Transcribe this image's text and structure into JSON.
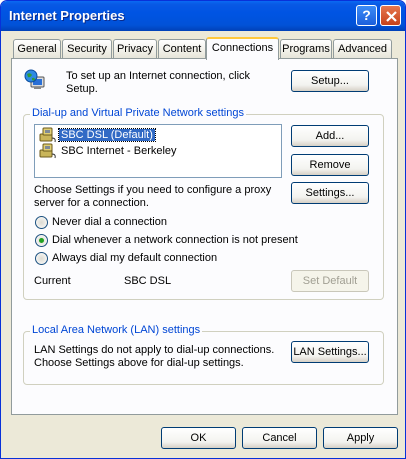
{
  "window": {
    "title": "Internet Properties",
    "help_glyph": "?",
    "close_icon": "close-x-icon"
  },
  "tabs": [
    {
      "label": "General"
    },
    {
      "label": "Security"
    },
    {
      "label": "Privacy"
    },
    {
      "label": "Content"
    },
    {
      "label": "Connections",
      "active": true
    },
    {
      "label": "Programs"
    },
    {
      "label": "Advanced"
    }
  ],
  "setup": {
    "text_line1": "To set up an Internet connection, click",
    "text_line2": "Setup.",
    "button": "Setup...",
    "icon": "globe-computer-icon"
  },
  "dialup": {
    "group_label": "Dial-up and Virtual Private Network settings",
    "connections": [
      {
        "label": "SBC DSL (Default)",
        "selected": true,
        "icon": "dialup-connection-icon"
      },
      {
        "label": "SBC Internet - Berkeley",
        "selected": false,
        "icon": "dialup-connection-icon"
      }
    ],
    "add_button": "Add...",
    "remove_button": "Remove",
    "settings_button": "Settings...",
    "proxy_text_line1": "Choose Settings if you need to configure a proxy",
    "proxy_text_line2": "server for a connection.",
    "options": [
      {
        "label": "Never dial a connection",
        "checked": false
      },
      {
        "label": "Dial whenever a network connection is not present",
        "checked": true
      },
      {
        "label": "Always dial my default connection",
        "checked": false
      }
    ],
    "current_label": "Current",
    "current_value": "SBC DSL",
    "set_default_button": "Set Default"
  },
  "lan": {
    "group_label": "Local Area Network (LAN) settings",
    "text_line1": "LAN Settings do not apply to dial-up connections.",
    "text_line2": "Choose Settings above for dial-up settings.",
    "button": "LAN Settings..."
  },
  "footer": {
    "ok": "OK",
    "cancel": "Cancel",
    "apply": "Apply"
  },
  "colors": {
    "titlebar": "#0054e3",
    "group_label": "#0046d5",
    "selection": "#316ac5",
    "active_tab_accent": "#ffc83c"
  }
}
